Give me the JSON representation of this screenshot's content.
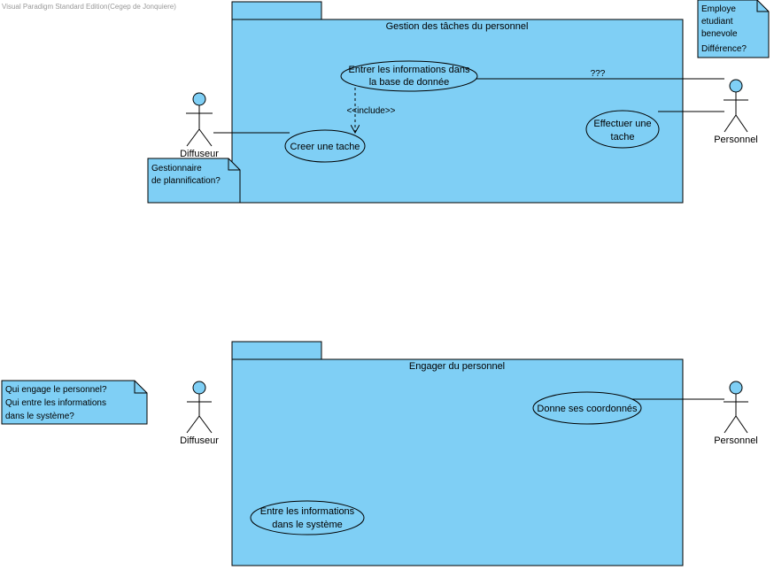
{
  "watermark": "Visual Paradigm Standard Edition(Cegep de Jonquiere)",
  "colors": {
    "fill": "#7fcff5",
    "stroke": "#000000",
    "watermark": "#999999"
  },
  "diagram1": {
    "package_title": "Gestion des tâches du personnel",
    "usecase_enter": [
      "Entrer les informations dans",
      "la base de donnée"
    ],
    "usecase_create": "Creer une tache",
    "usecase_perform": [
      "Effectuer une",
      "tache"
    ],
    "include_label": "<<include>>",
    "question_label": "???",
    "actor_left": "Diffuseur",
    "actor_right": "Personnel",
    "note_left": [
      "Gestionnaire",
      "de plannification?"
    ],
    "note_right": [
      "Employe",
      "etudiant",
      "benevole",
      "Différence?"
    ]
  },
  "diagram2": {
    "package_title": "Engager du personnel",
    "usecase_coords": "Donne ses coordonnés",
    "usecase_info": [
      "Entre les informations",
      "dans le système"
    ],
    "actor_left": "Diffuseur",
    "actor_right": "Personnel",
    "note_left": [
      "Qui engage le personnel?",
      "Qui entre les informations",
      "dans le système?"
    ]
  }
}
